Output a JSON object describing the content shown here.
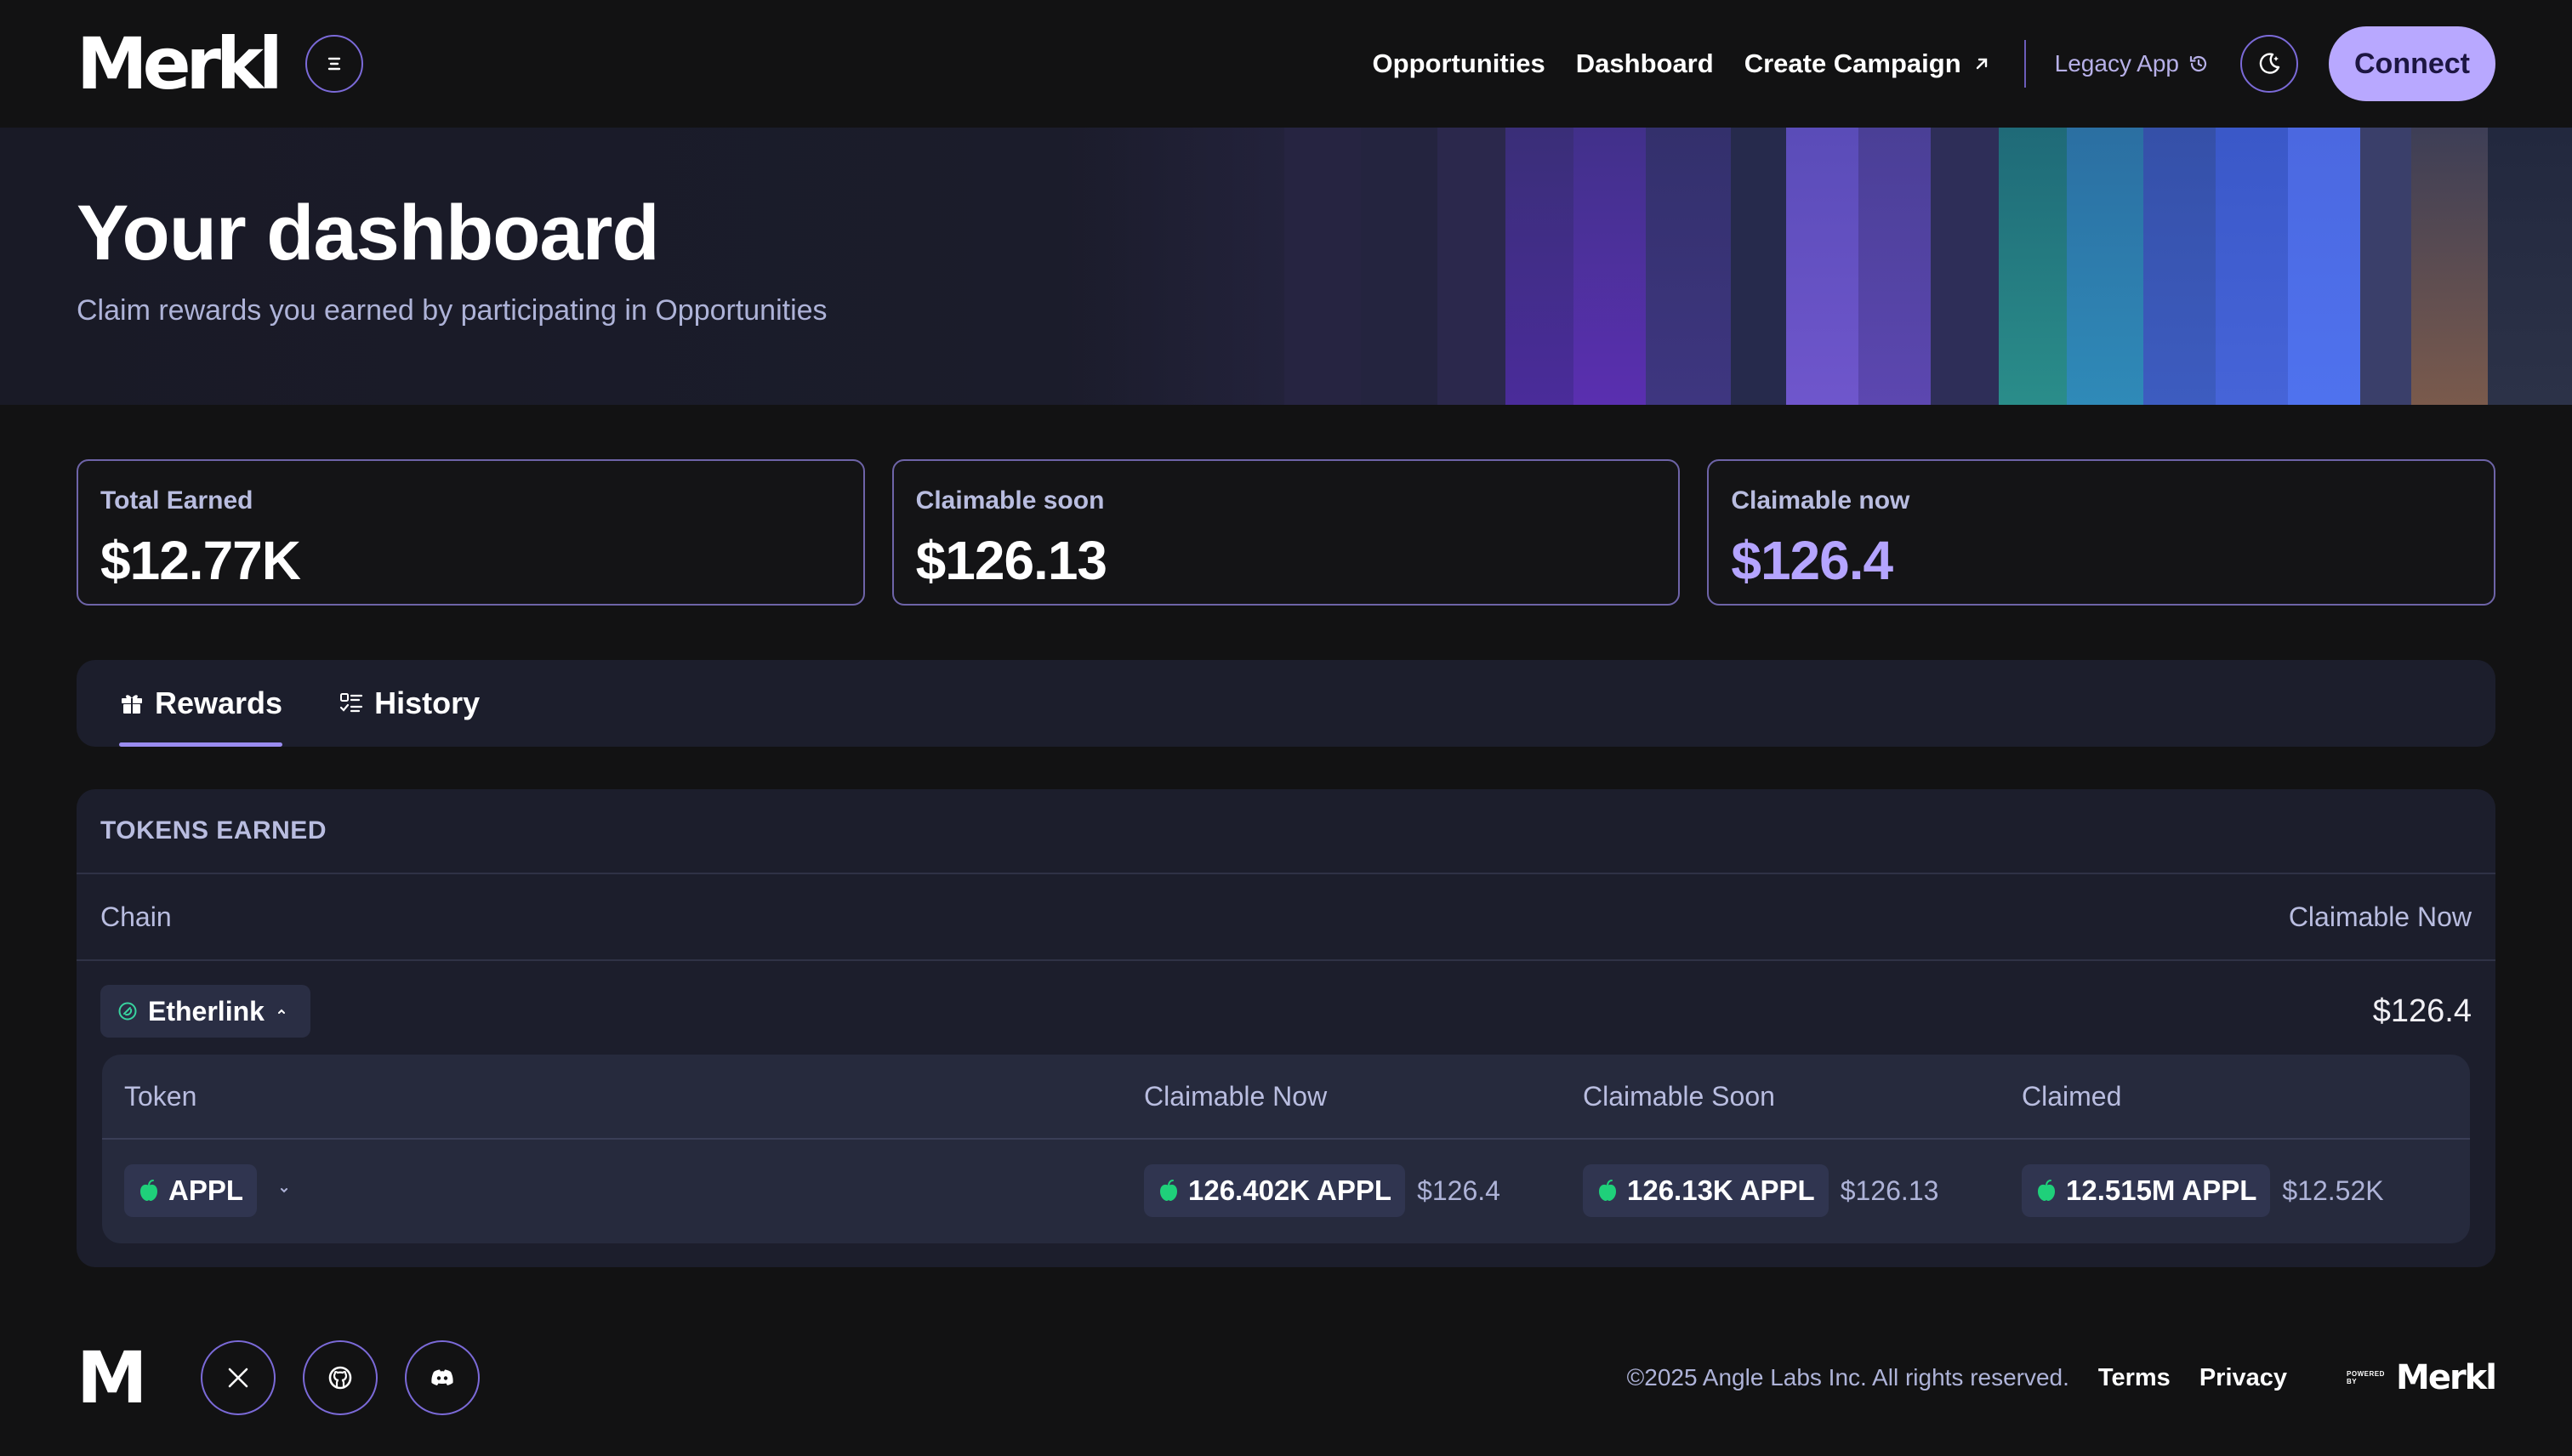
{
  "header": {
    "logo": "Merkl",
    "nav": {
      "opportunities": "Opportunities",
      "dashboard": "Dashboard",
      "create_campaign": "Create Campaign",
      "legacy_app": "Legacy App"
    },
    "connect": "Connect"
  },
  "hero": {
    "title": "Your dashboard",
    "subtitle": "Claim rewards you earned by participating in Opportunities"
  },
  "stats": {
    "total_earned": {
      "label": "Total Earned",
      "value": "$12.77K"
    },
    "claimable_soon": {
      "label": "Claimable soon",
      "value": "$126.13"
    },
    "claimable_now": {
      "label": "Claimable now",
      "value": "$126.4"
    }
  },
  "tabs": {
    "rewards": "Rewards",
    "history": "History"
  },
  "tokens": {
    "title": "TOKENS EARNED",
    "columns": {
      "chain": "Chain",
      "claimable_now": "Claimable Now"
    },
    "chain": {
      "name": "Etherlink",
      "claimable_now": "$126.4"
    },
    "inner_columns": {
      "token": "Token",
      "claimable_now": "Claimable Now",
      "claimable_soon": "Claimable Soon",
      "claimed": "Claimed"
    },
    "rows": [
      {
        "token": "APPL",
        "claimable_now": {
          "amount": "126.402K APPL",
          "usd": "$126.4"
        },
        "claimable_soon": {
          "amount": "126.13K APPL",
          "usd": "$126.13"
        },
        "claimed": {
          "amount": "12.515M APPL",
          "usd": "$12.52K"
        }
      }
    ]
  },
  "footer": {
    "copyright": "©2025 Angle Labs Inc. All rights reserved.",
    "terms": "Terms",
    "privacy": "Privacy",
    "powered_by": "POWERED BY",
    "logo": "Merkl",
    "mark": "M"
  },
  "colors": {
    "accent": "#b8a8ff",
    "accent_border": "#7b6ad8",
    "token_green": "#1fd07a"
  }
}
